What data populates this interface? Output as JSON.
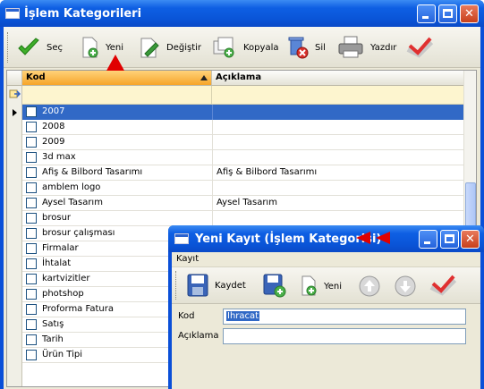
{
  "main_window": {
    "title": "İşlem Kategorileri",
    "toolbar": {
      "sec": "Seç",
      "yeni": "Yeni",
      "degistir": "Değiştir",
      "kopyala": "Kopyala",
      "sil": "Sil",
      "yazdir": "Yazdır"
    },
    "grid": {
      "columns": [
        "Kod",
        "Açıklama"
      ],
      "rows": [
        {
          "kod": "2007",
          "aciklama": ""
        },
        {
          "kod": "2008",
          "aciklama": ""
        },
        {
          "kod": "2009",
          "aciklama": ""
        },
        {
          "kod": "3d max",
          "aciklama": ""
        },
        {
          "kod": "Afiş & Bilbord Tasarımı",
          "aciklama": "Afiş & Bilbord Tasarımı"
        },
        {
          "kod": "amblem logo",
          "aciklama": ""
        },
        {
          "kod": "Aysel Tasarım",
          "aciklama": "Aysel Tasarım"
        },
        {
          "kod": "brosur",
          "aciklama": ""
        },
        {
          "kod": "brosur çalışması",
          "aciklama": ""
        },
        {
          "kod": "Firmalar",
          "aciklama": ""
        },
        {
          "kod": "İhtalat",
          "aciklama": ""
        },
        {
          "kod": "kartvizitler",
          "aciklama": ""
        },
        {
          "kod": "photshop",
          "aciklama": ""
        },
        {
          "kod": "Proforma Fatura",
          "aciklama": ""
        },
        {
          "kod": "Satış",
          "aciklama": ""
        },
        {
          "kod": "Tarih",
          "aciklama": ""
        },
        {
          "kod": "Ürün Tipi",
          "aciklama": ""
        }
      ]
    }
  },
  "dialog": {
    "title": "Yeni Kayıt (İşlem Kategorisi)",
    "menu": "Kayıt",
    "toolbar": {
      "kaydet": "Kaydet",
      "yeni": "Yeni"
    },
    "form": {
      "kod_label": "Kod",
      "kod_value": "İhracat",
      "aciklama_label": "Açıklama",
      "aciklama_value": ""
    }
  },
  "colors": {
    "title_blue": "#0a55d8",
    "selection": "#3169c6",
    "sorted_header": "#f6a52a",
    "annotation_red": "#e00000"
  }
}
